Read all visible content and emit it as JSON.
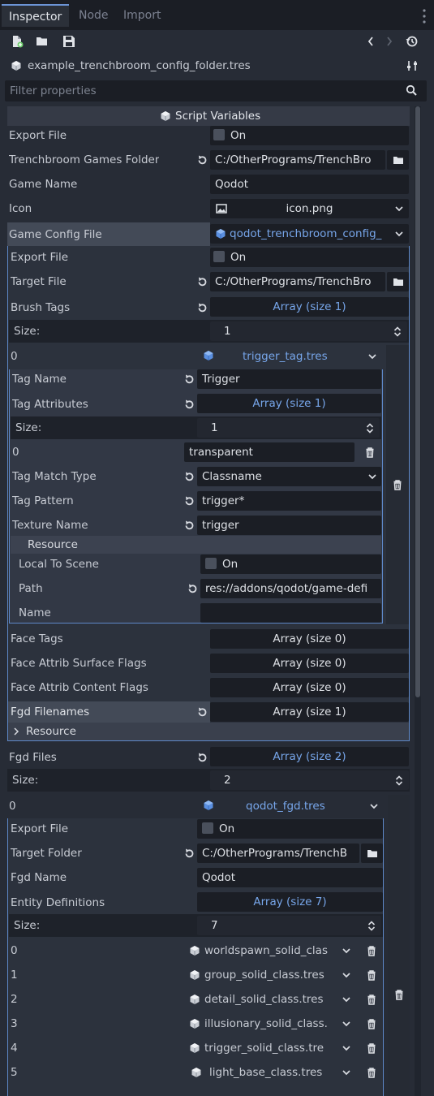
{
  "tabs": [
    "Inspector",
    "Node",
    "Import"
  ],
  "header": {
    "resource_name": "example_trenchbroom_config_folder.tres",
    "filter_placeholder": "Filter properties"
  },
  "script_vars_title": "Script Variables",
  "top": {
    "export_file_label": "Export File",
    "export_file_value": "On",
    "tb_games_folder_label": "Trenchbroom Games Folder",
    "tb_games_folder_value": "C:/OtherPrograms/TrenchBro",
    "game_name_label": "Game Name",
    "game_name_value": "Qodot",
    "icon_label": "Icon",
    "icon_value": "icon.png",
    "game_config_label": "Game Config File",
    "game_config_value": "qodot_trenchbroom_config_"
  },
  "gc": {
    "export_file_label": "Export File",
    "export_file_value": "On",
    "target_file_label": "Target File",
    "target_file_value": "C:/OtherPrograms/TrenchBro",
    "brush_tags_label": "Brush Tags",
    "brush_tags_value": "Array (size 1)",
    "size_label": "Size:",
    "size_value": "1",
    "item0_index": "0",
    "item0_value": "trigger_tag.tres"
  },
  "tag": {
    "name_label": "Tag Name",
    "name_value": "Trigger",
    "attr_label": "Tag Attributes",
    "attr_value": "Array (size 1)",
    "size_label": "Size:",
    "size_value": "1",
    "attr0_index": "0",
    "attr0_value": "transparent",
    "match_label": "Tag Match Type",
    "match_value": "Classname",
    "pattern_label": "Tag Pattern",
    "pattern_value": "trigger*",
    "texture_label": "Texture Name",
    "texture_value": "trigger",
    "resource_label": "Resource",
    "local_label": "Local To Scene",
    "local_value": "On",
    "path_label": "Path",
    "path_value": "res://addons/qodot/game-defi",
    "rname_label": "Name",
    "rname_value": ""
  },
  "gc2": {
    "face_tags_label": "Face Tags",
    "face_tags_value": "Array (size 0)",
    "surf_label": "Face Attrib Surface Flags",
    "surf_value": "Array (size 0)",
    "content_label": "Face Attrib Content Flags",
    "content_value": "Array (size 0)",
    "fgd_filenames_label": "Fgd Filenames",
    "fgd_filenames_value": "Array (size 1)",
    "resource_label": "Resource"
  },
  "fgd": {
    "files_label": "Fgd Files",
    "files_value": "Array (size 2)",
    "size_label": "Size:",
    "size_value": "2",
    "item0_index": "0",
    "item0_value": "qodot_fgd.tres"
  },
  "fgd_res": {
    "export_file_label": "Export File",
    "export_file_value": "On",
    "target_folder_label": "Target Folder",
    "target_folder_value": "C:/OtherPrograms/TrenchB",
    "fgd_name_label": "Fgd Name",
    "fgd_name_value": "Qodot",
    "entity_defs_label": "Entity Definitions",
    "entity_defs_value": "Array (size 7)",
    "size_label": "Size:",
    "size_value": "7",
    "entities": [
      {
        "index": "0",
        "value": "worldspawn_solid_clas"
      },
      {
        "index": "1",
        "value": "group_solid_class.tres"
      },
      {
        "index": "2",
        "value": "detail_solid_class.tres"
      },
      {
        "index": "3",
        "value": "illusionary_solid_class."
      },
      {
        "index": "4",
        "value": "trigger_solid_class.tre"
      },
      {
        "index": "5",
        "value": "light_base_class.tres"
      }
    ]
  },
  "colors": {
    "accent": "#6c94d6",
    "link": "#77a6ea",
    "background": "#272c36"
  }
}
